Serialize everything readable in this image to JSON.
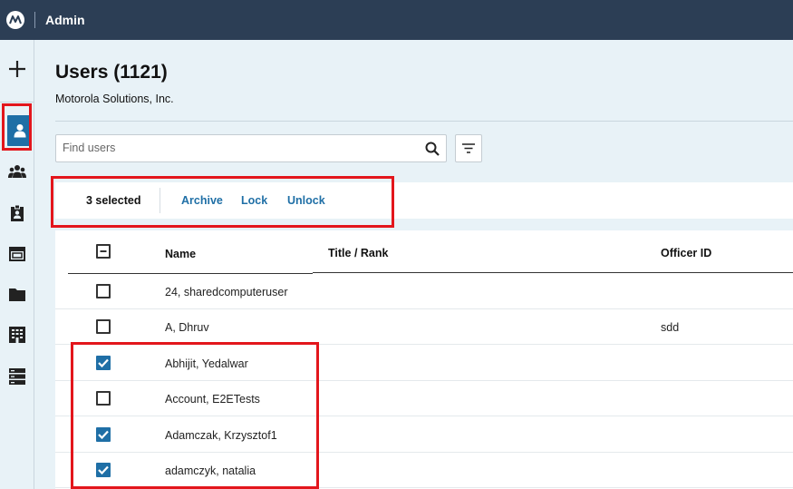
{
  "header": {
    "app_title": "Admin"
  },
  "page": {
    "title": "Users (1121)",
    "organization": "Motorola Solutions, Inc."
  },
  "search": {
    "placeholder": "Find users",
    "value": ""
  },
  "selection": {
    "count_label": "3 selected",
    "actions": [
      "Archive",
      "Lock",
      "Unlock"
    ]
  },
  "table": {
    "columns": [
      "Name",
      "Title / Rank",
      "Officer ID"
    ],
    "header_checkbox_state": "indeterminate",
    "rows": [
      {
        "name": "24, sharedcomputeruser",
        "title": "",
        "officer_id": "",
        "checked": false
      },
      {
        "name": "A, Dhruv",
        "title": "",
        "officer_id": "sdd",
        "checked": false
      },
      {
        "name": "Abhijit, Yedalwar",
        "title": "",
        "officer_id": "",
        "checked": true
      },
      {
        "name": "Account, E2ETests",
        "title": "",
        "officer_id": "",
        "checked": false
      },
      {
        "name": "Adamczak, Krzysztof1",
        "title": "",
        "officer_id": "",
        "checked": true
      },
      {
        "name": "adamczyk, natalia",
        "title": "",
        "officer_id": "",
        "checked": true
      }
    ]
  },
  "sidebar": {
    "items": [
      "plus-icon",
      "user-icon",
      "users-group-icon",
      "id-badge-icon",
      "browser-window-icon",
      "folder-icon",
      "building-icon",
      "server-icon"
    ],
    "active": "user-icon"
  },
  "colors": {
    "topbar": "#2c3e55",
    "accent": "#1f6fa6",
    "highlight": "#e3161c",
    "background": "#e8f2f7"
  }
}
